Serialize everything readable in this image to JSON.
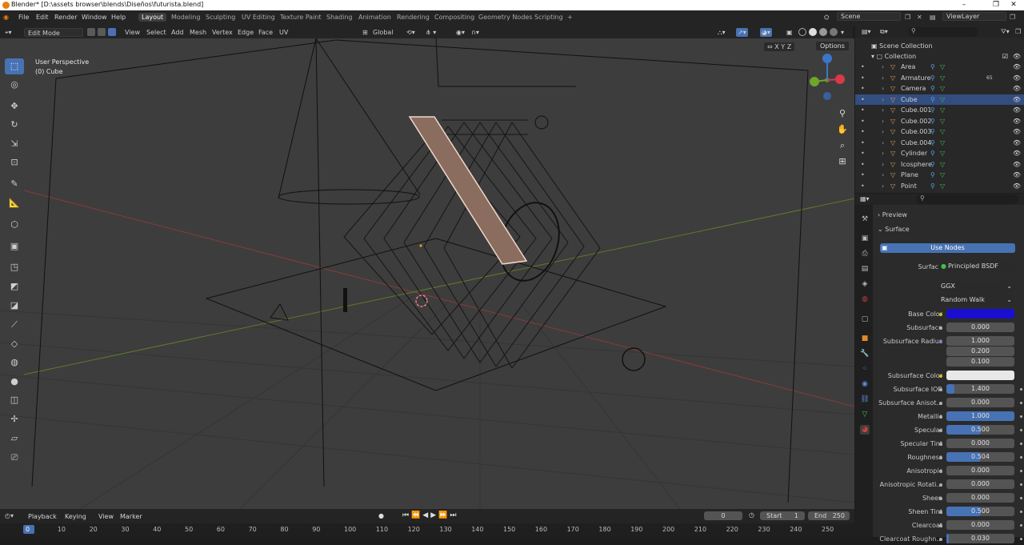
{
  "window": {
    "title": "Blender* [D:\\assets browser\\blends\\Diseños\\futurista.blend]"
  },
  "menu": [
    "File",
    "Edit",
    "Render",
    "Window",
    "Help"
  ],
  "workspaces": [
    "Layout",
    "Modeling",
    "Sculpting",
    "UV Editing",
    "Texture Paint",
    "Shading",
    "Animation",
    "Rendering",
    "Compositing",
    "Geometry Nodes",
    "Scripting",
    "+"
  ],
  "scene": {
    "name": "Scene",
    "view_layer": "ViewLayer"
  },
  "viewport_header": {
    "mode": "Edit Mode",
    "menus": [
      "View",
      "Select",
      "Add",
      "Mesh",
      "Vertex",
      "Edge",
      "Face",
      "UV"
    ],
    "transform_orientation": "Global",
    "axes": [
      "X",
      "Y",
      "Z"
    ],
    "options": "Options"
  },
  "viewport_info": {
    "view": "User Perspective",
    "object": "(0) Cube"
  },
  "outliner": {
    "scene_collection": "Scene Collection",
    "collection": "Collection",
    "items": [
      {
        "name": "Area",
        "color": "#e0a060"
      },
      {
        "name": "Armature",
        "color": "#e0a060",
        "badge": "65"
      },
      {
        "name": "Camera",
        "color": "#e0a060"
      },
      {
        "name": "Cube",
        "color": "#e0a060",
        "selected": true
      },
      {
        "name": "Cube.001",
        "color": "#e0a060"
      },
      {
        "name": "Cube.002",
        "color": "#e0a060"
      },
      {
        "name": "Cube.003",
        "color": "#e0a060"
      },
      {
        "name": "Cube.004",
        "color": "#e0a060"
      },
      {
        "name": "Cylinder",
        "color": "#e0a060"
      },
      {
        "name": "Icosphere",
        "color": "#e0a060"
      },
      {
        "name": "Plane",
        "color": "#e0a060"
      },
      {
        "name": "Point",
        "color": "#e0a060"
      }
    ]
  },
  "properties": {
    "panels": {
      "preview": "Preview",
      "surface": "Surface"
    },
    "use_nodes": "Use Nodes",
    "surface_label": "Surface",
    "surface_value": "Principled BSDF",
    "distribution": "GGX",
    "subsurface_method": "Random Walk",
    "base_color_label": "Base Color",
    "base_color": "#1a0fd0",
    "subsurface_color_label": "Subsurface Color",
    "subsurface_color": "#e8e8e8",
    "subsurface_radius_label": "Subsurface Radius",
    "subsurface_radius": [
      "1.000",
      "0.200",
      "0.100"
    ],
    "fields": [
      {
        "label": "Subsurface",
        "value": "0.000",
        "fill": 0
      },
      {
        "label": "Subsurface IOR",
        "value": "1.400",
        "fill": 0.12
      },
      {
        "label": "Subsurface Anisot...",
        "value": "0.000",
        "fill": 0
      },
      {
        "label": "Metallic",
        "value": "1.000",
        "fill": 1
      },
      {
        "label": "Specular",
        "value": "0.500",
        "fill": 0.5
      },
      {
        "label": "Specular Tint",
        "value": "0.000",
        "fill": 0
      },
      {
        "label": "Roughness",
        "value": "0.504",
        "fill": 0.504
      },
      {
        "label": "Anisotropic",
        "value": "0.000",
        "fill": 0
      },
      {
        "label": "Anisotropic Rotati...",
        "value": "0.000",
        "fill": 0
      },
      {
        "label": "Sheen",
        "value": "0.000",
        "fill": 0
      },
      {
        "label": "Sheen Tint",
        "value": "0.500",
        "fill": 0.5
      },
      {
        "label": "Clearcoat",
        "value": "0.000",
        "fill": 0
      },
      {
        "label": "Clearcoat Roughn...",
        "value": "0.030",
        "fill": 0.03
      }
    ]
  },
  "timeline": {
    "menus": [
      "Playback",
      "Keying",
      "View",
      "Marker"
    ],
    "current_frame": "0",
    "start_label": "Start",
    "start": "1",
    "end_label": "End",
    "end": "250",
    "ruler": [
      "0",
      "10",
      "20",
      "30",
      "40",
      "50",
      "60",
      "70",
      "80",
      "90",
      "100",
      "110",
      "120",
      "130",
      "140",
      "150",
      "160",
      "170",
      "180",
      "190",
      "200",
      "210",
      "220",
      "230",
      "240",
      "250"
    ]
  }
}
